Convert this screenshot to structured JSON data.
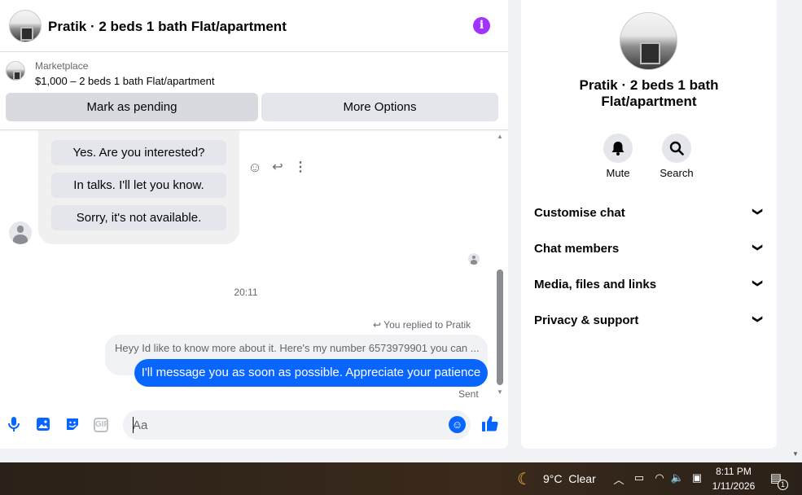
{
  "header": {
    "title": "Pratik · 2 beds 1 bath Flat/apartment",
    "info_icon": "info-icon"
  },
  "listing": {
    "label": "Marketplace",
    "price_title": "$1,000 – 2 beds 1 bath Flat/apartment"
  },
  "actions": {
    "mark_pending": "Mark as pending",
    "more_options": "More Options"
  },
  "messages": {
    "quick_replies": [
      "Yes. Are you interested?",
      "In talks. I'll let you know.",
      "Sorry, it's not available."
    ],
    "timestamp": "20:11",
    "replied_label": "You replied to Pratik",
    "quoted_text": "Heyy Id like to know more about it. Here's my number 6573979901 you can ...",
    "sent_text": "I'll message you as soon as possible. Appreciate your patience",
    "status": "Sent"
  },
  "composer": {
    "placeholder": "Aa",
    "gif_label": "GIF"
  },
  "info_panel": {
    "title": "Pratik · 2 beds 1 bath Flat/apartment",
    "mute_label": "Mute",
    "search_label": "Search",
    "sections": [
      "Customise chat",
      "Chat members",
      "Media, files and links",
      "Privacy & support"
    ]
  },
  "taskbar": {
    "temperature": "9°C",
    "weather": "Clear",
    "time": "8:11 PM",
    "date": "1/11/2026",
    "notification_count": "1"
  },
  "colors": {
    "accent": "#0866ff",
    "info": "#a033ff"
  }
}
